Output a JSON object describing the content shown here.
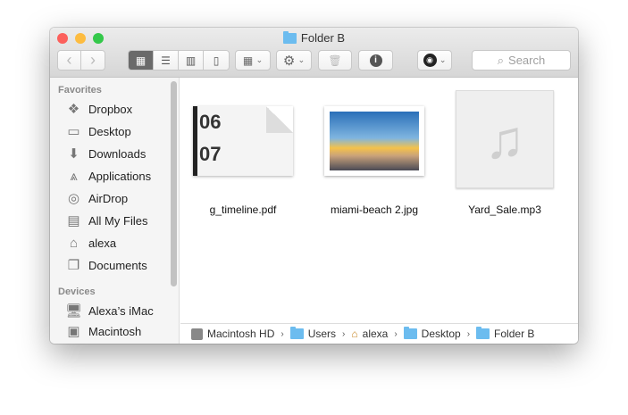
{
  "window": {
    "title": "Folder B"
  },
  "toolbar": {
    "back": "‹",
    "forward": "›",
    "search_placeholder": "Search"
  },
  "sidebar": {
    "favorites_label": "Favorites",
    "favorites": [
      {
        "label": "Dropbox",
        "icon": "dropbox-icon"
      },
      {
        "label": "Desktop",
        "icon": "desktop-icon"
      },
      {
        "label": "Downloads",
        "icon": "downloads-icon"
      },
      {
        "label": "Applications",
        "icon": "applications-icon"
      },
      {
        "label": "AirDrop",
        "icon": "airdrop-icon"
      },
      {
        "label": "All My Files",
        "icon": "all-files-icon"
      },
      {
        "label": "alexa",
        "icon": "home-icon"
      },
      {
        "label": "Documents",
        "icon": "documents-icon"
      }
    ],
    "devices_label": "Devices",
    "devices": [
      {
        "label": "Alexa’s iMac",
        "icon": "imac-icon"
      },
      {
        "label": "Macintosh",
        "icon": "disk-icon"
      }
    ]
  },
  "files": [
    {
      "name": "g_timeline.pdf",
      "thumb_text": [
        "06",
        "07"
      ]
    },
    {
      "name": "miami-beach 2.jpg"
    },
    {
      "name": "Yard_Sale.mp3"
    }
  ],
  "path": [
    "Macintosh HD",
    "Users",
    "alexa",
    "Desktop",
    "Folder B"
  ],
  "colors": {
    "close": "#fc605c",
    "minimize": "#fdbc40",
    "zoom": "#34c84a",
    "folder": "#6cbcef"
  }
}
